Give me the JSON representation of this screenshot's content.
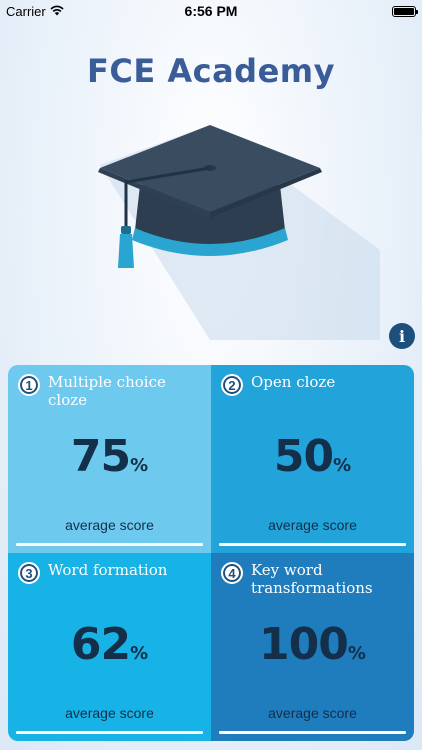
{
  "status_bar": {
    "carrier": "Carrier",
    "time": "6:56 PM",
    "wifi_icon": "wifi-icon",
    "battery_icon": "battery-icon"
  },
  "app": {
    "title": "FCE Academy",
    "logo_icon": "graduation-cap-icon",
    "info_icon": "info-icon",
    "info_label": "i"
  },
  "colors": {
    "title": "#3a5c98",
    "tile1": "#6ec9ef",
    "tile2": "#22a3da",
    "tile3": "#17b3e6",
    "tile4": "#1f7cbd",
    "score_text": "#132f4a"
  },
  "tiles": [
    {
      "number": "1",
      "label": "Multiple choice cloze",
      "score": "75",
      "unit": "%",
      "caption": "average score",
      "progress": 1.0
    },
    {
      "number": "2",
      "label": "Open cloze",
      "score": "50",
      "unit": "%",
      "caption": "average score",
      "progress": 1.0
    },
    {
      "number": "3",
      "label": "Word formation",
      "score": "62",
      "unit": "%",
      "caption": "average score",
      "progress": 1.0
    },
    {
      "number": "4",
      "label": "Key word transformations",
      "score": "100",
      "unit": "%",
      "caption": "average score",
      "progress": 1.0
    }
  ]
}
